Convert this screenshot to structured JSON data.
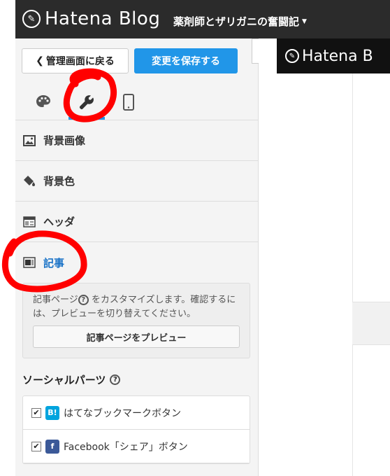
{
  "topbar": {
    "logo_text": "Hatena Blog",
    "blog_name": "薬剤師とザリガニの奮闘記"
  },
  "header": {
    "back_label": "管理画面に戻る",
    "save_label": "変更を保存する"
  },
  "tabs": [
    {
      "name": "design",
      "icon": "palette-icon"
    },
    {
      "name": "customize",
      "icon": "wrench-icon",
      "active": true
    },
    {
      "name": "smartphone",
      "icon": "smartphone-icon"
    }
  ],
  "menu": {
    "items": [
      {
        "label": "背景画像",
        "icon": "image-icon"
      },
      {
        "label": "背景色",
        "icon": "paint-bucket-icon"
      },
      {
        "label": "ヘッダ",
        "icon": "header-layout-icon"
      },
      {
        "label": "記事",
        "icon": "article-layout-icon",
        "active": true
      }
    ]
  },
  "article_panel": {
    "description": "記事ページ",
    "description_rest": "をカスタマイズします。確認するには、プレビューを切り替えてください。",
    "preview_button": "記事ページをプレビュー"
  },
  "social": {
    "title": "ソーシャルパーツ",
    "items": [
      {
        "label": "はてなブックマークボタン",
        "badge": "B!",
        "badge_color": "#00a4de",
        "checked": true
      },
      {
        "label": "Facebook「シェア」ボタン",
        "badge": "f",
        "badge_color": "#3b5998",
        "checked": true
      }
    ]
  },
  "preview": {
    "logo_text": "Hatena B"
  },
  "colors": {
    "accent": "#2196e8",
    "annotation": "#ff0000"
  }
}
